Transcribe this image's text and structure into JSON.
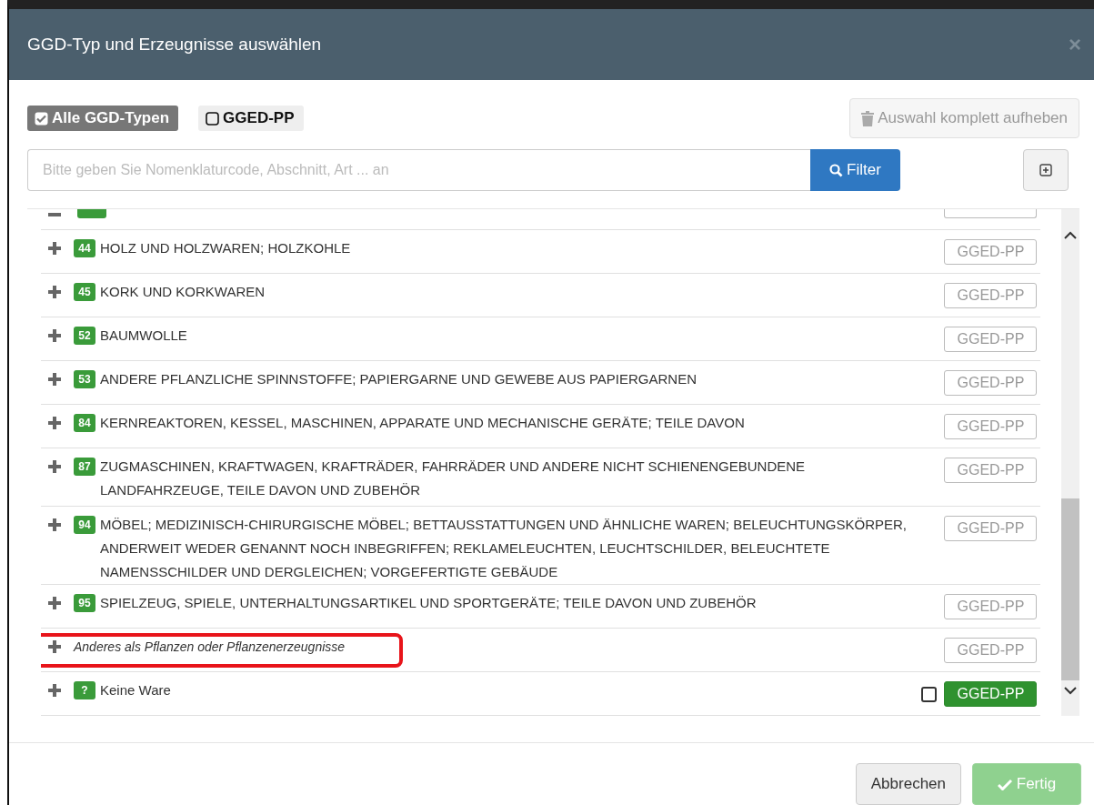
{
  "dialog": {
    "title": "GGD-Typ und Erzeugnisse auswählen",
    "close": "×"
  },
  "type_toggles": [
    {
      "label": "Alle GGD-Typen",
      "selected": true
    },
    {
      "label": "GGED-PP",
      "selected": false
    }
  ],
  "clear_button": "Auswahl komplett aufheben",
  "search": {
    "placeholder": "Bitte geben Sie Nomenklaturcode, Abschnitt, Art ... an",
    "button": "Filter"
  },
  "rows": [
    {
      "kind": "cut"
    },
    {
      "kind": "chapter",
      "code": "44",
      "text": "HOLZ UND HOLZWAREN; HOLZKOHLE",
      "highlighted": false,
      "tag": {
        "label": "GGED-PP",
        "selected": false
      }
    },
    {
      "kind": "chapter",
      "code": "45",
      "text": "KORK UND KORKWAREN",
      "highlighted": false,
      "tag": {
        "label": "GGED-PP",
        "selected": false
      }
    },
    {
      "kind": "chapter",
      "code": "52",
      "text": "BAUMWOLLE",
      "highlighted": false,
      "tag": {
        "label": "GGED-PP",
        "selected": false
      }
    },
    {
      "kind": "chapter",
      "code": "53",
      "text": "ANDERE PFLANZLICHE SPINNSTOFFE; PAPIERGARNE UND GEWEBE AUS PAPIERGARNEN",
      "highlighted": false,
      "tag": {
        "label": "GGED-PP",
        "selected": false
      }
    },
    {
      "kind": "chapter",
      "code": "84",
      "text": "KERNREAKTOREN, KESSEL, MASCHINEN, APPARATE UND MECHANISCHE GERÄTE; TEILE DAVON",
      "highlighted": false,
      "tag": {
        "label": "GGED-PP",
        "selected": false
      }
    },
    {
      "kind": "chapter",
      "code": "87",
      "text": "ZUGMASCHINEN, KRAFTWAGEN, KRAFTRÄDER, FAHRRÄDER UND ANDERE NICHT SCHIENENGEBUNDENE LANDFAHRZEUGE, TEILE DAVON UND ZUBEHÖR",
      "highlighted": false,
      "tag": {
        "label": "GGED-PP",
        "selected": false
      }
    },
    {
      "kind": "chapter",
      "code": "94",
      "text": "MÖBEL; MEDIZINISCH-CHIRURGISCHE MÖBEL; BETTAUSSTATTUNGEN UND ÄHNLICHE WAREN; BELEUCHTUNGSKÖRPER, ANDERWEIT WEDER GENANNT NOCH INBEGRIFFEN; REKLAMELEUCHTEN, LEUCHTSCHILDER, BELEUCHTETE NAMENSSCHILDER UND DERGLEICHEN; VORGEFERTIGTE GEBÄUDE",
      "highlighted": false,
      "tag": {
        "label": "GGED-PP",
        "selected": false
      }
    },
    {
      "kind": "chapter",
      "code": "95",
      "text": "SPIELZEUG, SPIELE, UNTERHALTUNGSARTIKEL UND SPORTGERÄTE; TEILE DAVON UND ZUBEHÖR",
      "highlighted": false,
      "tag": {
        "label": "GGED-PP",
        "selected": false
      }
    },
    {
      "kind": "other",
      "text": "Anderes als Pflanzen oder Pflanzenerzeugnisse",
      "highlighted": true,
      "tag": {
        "label": "GGED-PP",
        "selected": false
      }
    },
    {
      "kind": "chapter",
      "code": "?",
      "text": "Keine Ware",
      "highlighted": false,
      "checkbox": {
        "checked": false
      },
      "tag": {
        "label": "GGED-PP",
        "selected": true
      }
    }
  ],
  "footer": {
    "cancel": "Abbrechen",
    "done": "Fertig"
  }
}
